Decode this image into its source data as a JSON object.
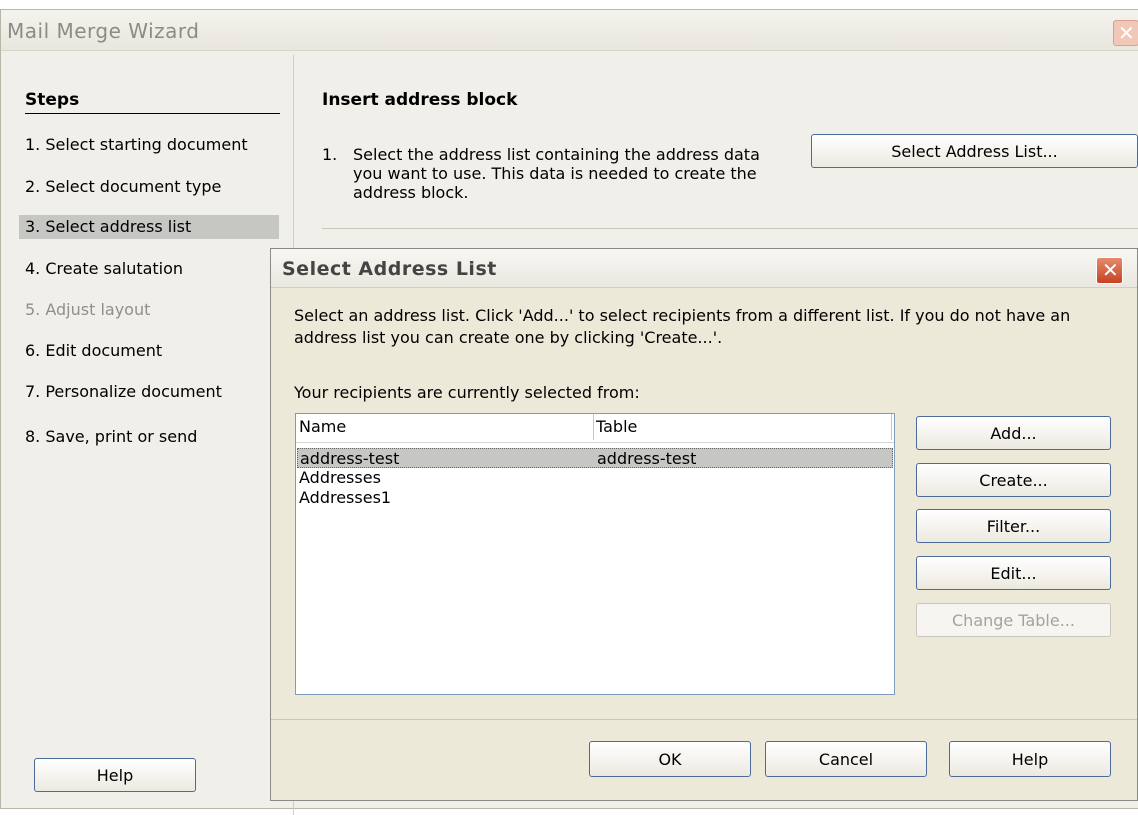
{
  "wizard": {
    "title": "Mail Merge Wizard",
    "steps_heading": "Steps",
    "steps": [
      {
        "label": "1.  Select starting document"
      },
      {
        "label": "2.  Select document type"
      },
      {
        "label": "3.  Select address list"
      },
      {
        "label": "4.  Create salutation"
      },
      {
        "label": "5.  Adjust layout"
      },
      {
        "label": "6.  Edit document"
      },
      {
        "label": "7.  Personalize document"
      },
      {
        "label": "8.  Save, print or send"
      }
    ],
    "section_title": "Insert address block",
    "instruction_num": "1.",
    "instruction_text": "Select the address list containing the address data you want to use. This data is needed to create the address block.",
    "select_address_list_button": "Select Address List...",
    "help_button": "Help"
  },
  "dialog": {
    "title": "Select Address List",
    "description": "Select an address list. Click 'Add...' to select recipients from a different list. If you do not have an address list you can create one by clicking 'Create...'.",
    "subheading": "Your recipients are currently selected from:",
    "columns": [
      "Name",
      "Table"
    ],
    "rows": [
      {
        "name": "address-test",
        "table": "address-test"
      },
      {
        "name": "Addresses",
        "table": ""
      },
      {
        "name": "Addresses1",
        "table": ""
      }
    ],
    "buttons": {
      "add": "Add...",
      "create": "Create...",
      "filter": "Filter...",
      "edit": "Edit...",
      "change_table": "Change Table...",
      "ok": "OK",
      "cancel": "Cancel",
      "help": "Help"
    }
  }
}
